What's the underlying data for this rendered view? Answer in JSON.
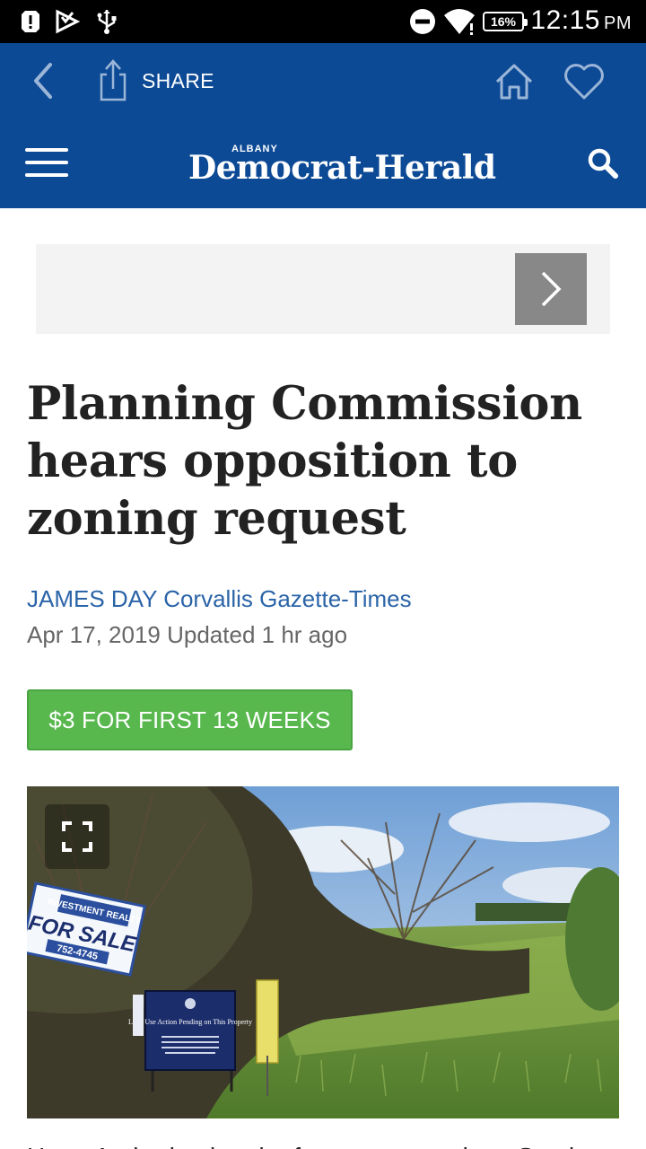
{
  "status_bar": {
    "time": "12:15",
    "ampm": "PM",
    "battery": "16%"
  },
  "app_bar": {
    "share_label": "SHARE",
    "masthead_small": "ALBANY",
    "masthead_title": "Democrat-Herald",
    "color": "#0d4a96"
  },
  "article": {
    "headline": "Planning Commission hears opposition to zoning request",
    "byline": "JAMES DAY Corvallis Gazette-Times",
    "dateline": "Apr 17, 2019 Updated 1 hr ago",
    "cta_label": "$3 FOR FIRST 13 WEEKS",
    "photo_signs": {
      "sale_sign_top": "INVESTMENT REALTY",
      "sale_sign_main": "FOR SALE",
      "sale_sign_phone": "752-4745",
      "notice_title": "Land Use Action Pending on This Property"
    },
    "body_first_line": "Harry Andrade, that the farm acreage along Southwest"
  },
  "colors": {
    "brand_blue": "#0d4a96",
    "link_blue": "#2b64a8",
    "cta_green": "#58b84e"
  }
}
